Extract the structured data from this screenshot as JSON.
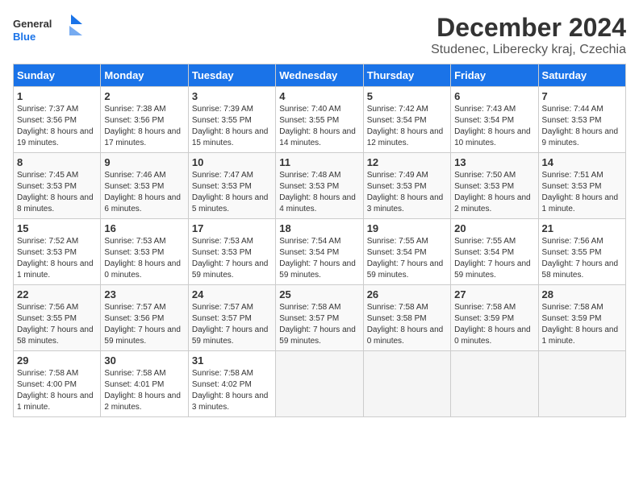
{
  "header": {
    "logo_general": "General",
    "logo_blue": "Blue",
    "month_title": "December 2024",
    "location": "Studenec, Liberecky kraj, Czechia"
  },
  "days_of_week": [
    "Sunday",
    "Monday",
    "Tuesday",
    "Wednesday",
    "Thursday",
    "Friday",
    "Saturday"
  ],
  "weeks": [
    [
      {
        "day": "1",
        "sunrise": "7:37 AM",
        "sunset": "3:56 PM",
        "daylight": "8 hours and 19 minutes."
      },
      {
        "day": "2",
        "sunrise": "7:38 AM",
        "sunset": "3:56 PM",
        "daylight": "8 hours and 17 minutes."
      },
      {
        "day": "3",
        "sunrise": "7:39 AM",
        "sunset": "3:55 PM",
        "daylight": "8 hours and 15 minutes."
      },
      {
        "day": "4",
        "sunrise": "7:40 AM",
        "sunset": "3:55 PM",
        "daylight": "8 hours and 14 minutes."
      },
      {
        "day": "5",
        "sunrise": "7:42 AM",
        "sunset": "3:54 PM",
        "daylight": "8 hours and 12 minutes."
      },
      {
        "day": "6",
        "sunrise": "7:43 AM",
        "sunset": "3:54 PM",
        "daylight": "8 hours and 10 minutes."
      },
      {
        "day": "7",
        "sunrise": "7:44 AM",
        "sunset": "3:53 PM",
        "daylight": "8 hours and 9 minutes."
      }
    ],
    [
      {
        "day": "8",
        "sunrise": "7:45 AM",
        "sunset": "3:53 PM",
        "daylight": "8 hours and 8 minutes."
      },
      {
        "day": "9",
        "sunrise": "7:46 AM",
        "sunset": "3:53 PM",
        "daylight": "8 hours and 6 minutes."
      },
      {
        "day": "10",
        "sunrise": "7:47 AM",
        "sunset": "3:53 PM",
        "daylight": "8 hours and 5 minutes."
      },
      {
        "day": "11",
        "sunrise": "7:48 AM",
        "sunset": "3:53 PM",
        "daylight": "8 hours and 4 minutes."
      },
      {
        "day": "12",
        "sunrise": "7:49 AM",
        "sunset": "3:53 PM",
        "daylight": "8 hours and 3 minutes."
      },
      {
        "day": "13",
        "sunrise": "7:50 AM",
        "sunset": "3:53 PM",
        "daylight": "8 hours and 2 minutes."
      },
      {
        "day": "14",
        "sunrise": "7:51 AM",
        "sunset": "3:53 PM",
        "daylight": "8 hours and 1 minute."
      }
    ],
    [
      {
        "day": "15",
        "sunrise": "7:52 AM",
        "sunset": "3:53 PM",
        "daylight": "8 hours and 1 minute."
      },
      {
        "day": "16",
        "sunrise": "7:53 AM",
        "sunset": "3:53 PM",
        "daylight": "8 hours and 0 minutes."
      },
      {
        "day": "17",
        "sunrise": "7:53 AM",
        "sunset": "3:53 PM",
        "daylight": "7 hours and 59 minutes."
      },
      {
        "day": "18",
        "sunrise": "7:54 AM",
        "sunset": "3:54 PM",
        "daylight": "7 hours and 59 minutes."
      },
      {
        "day": "19",
        "sunrise": "7:55 AM",
        "sunset": "3:54 PM",
        "daylight": "7 hours and 59 minutes."
      },
      {
        "day": "20",
        "sunrise": "7:55 AM",
        "sunset": "3:54 PM",
        "daylight": "7 hours and 59 minutes."
      },
      {
        "day": "21",
        "sunrise": "7:56 AM",
        "sunset": "3:55 PM",
        "daylight": "7 hours and 58 minutes."
      }
    ],
    [
      {
        "day": "22",
        "sunrise": "7:56 AM",
        "sunset": "3:55 PM",
        "daylight": "7 hours and 58 minutes."
      },
      {
        "day": "23",
        "sunrise": "7:57 AM",
        "sunset": "3:56 PM",
        "daylight": "7 hours and 59 minutes."
      },
      {
        "day": "24",
        "sunrise": "7:57 AM",
        "sunset": "3:57 PM",
        "daylight": "7 hours and 59 minutes."
      },
      {
        "day": "25",
        "sunrise": "7:58 AM",
        "sunset": "3:57 PM",
        "daylight": "7 hours and 59 minutes."
      },
      {
        "day": "26",
        "sunrise": "7:58 AM",
        "sunset": "3:58 PM",
        "daylight": "8 hours and 0 minutes."
      },
      {
        "day": "27",
        "sunrise": "7:58 AM",
        "sunset": "3:59 PM",
        "daylight": "8 hours and 0 minutes."
      },
      {
        "day": "28",
        "sunrise": "7:58 AM",
        "sunset": "3:59 PM",
        "daylight": "8 hours and 1 minute."
      }
    ],
    [
      {
        "day": "29",
        "sunrise": "7:58 AM",
        "sunset": "4:00 PM",
        "daylight": "8 hours and 1 minute."
      },
      {
        "day": "30",
        "sunrise": "7:58 AM",
        "sunset": "4:01 PM",
        "daylight": "8 hours and 2 minutes."
      },
      {
        "day": "31",
        "sunrise": "7:58 AM",
        "sunset": "4:02 PM",
        "daylight": "8 hours and 3 minutes."
      },
      null,
      null,
      null,
      null
    ]
  ],
  "labels": {
    "sunrise": "Sunrise:",
    "sunset": "Sunset:",
    "daylight": "Daylight:"
  }
}
